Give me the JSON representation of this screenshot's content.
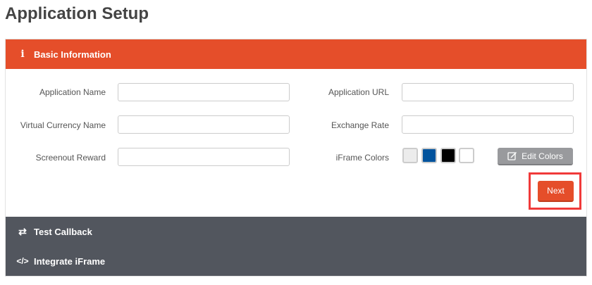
{
  "page_title": "Application Setup",
  "sections": {
    "basic": "Basic Information",
    "callback": "Test Callback",
    "iframe": "Integrate iFrame"
  },
  "fields": {
    "app_name": {
      "label": "Application Name",
      "value": ""
    },
    "currency_name": {
      "label": "Virtual Currency Name",
      "value": ""
    },
    "screenout": {
      "label": "Screenout Reward",
      "value": ""
    },
    "app_url": {
      "label": "Application URL",
      "value": ""
    },
    "exchange_rate": {
      "label": "Exchange Rate",
      "value": ""
    }
  },
  "iframe_colors": {
    "label": "iFrame Colors",
    "swatches": [
      "#ececec",
      "#01539d",
      "#000000",
      "#ffffff"
    ]
  },
  "buttons": {
    "edit_colors": "Edit Colors",
    "next": "Next"
  },
  "accent": "#e54e2a"
}
